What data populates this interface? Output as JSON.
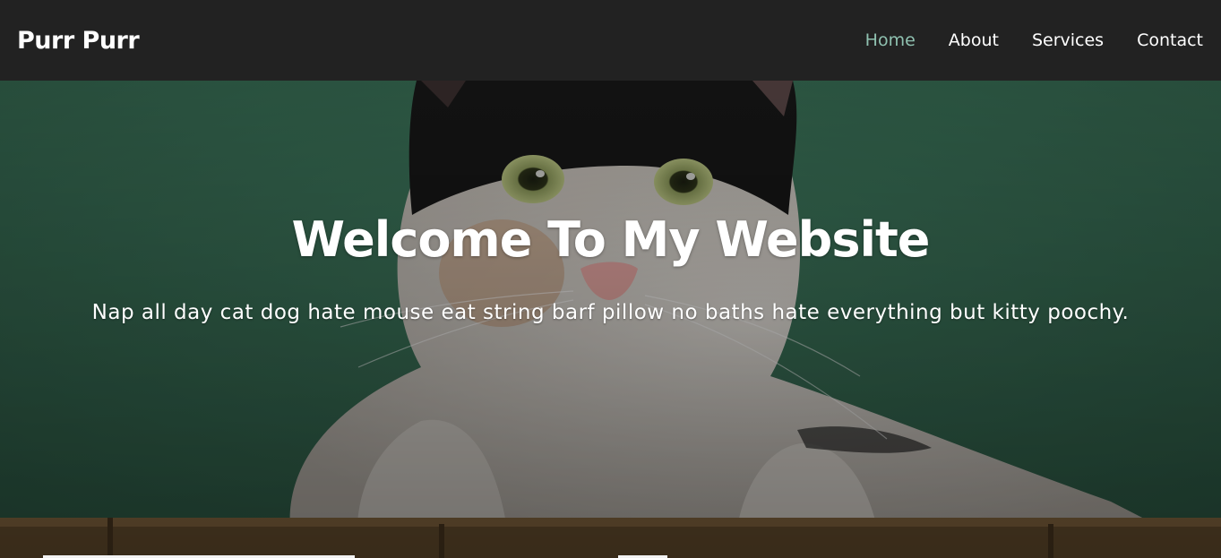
{
  "navbar": {
    "brand": "Purr Purr",
    "links": [
      {
        "label": "Home",
        "active": true
      },
      {
        "label": "About",
        "active": false
      },
      {
        "label": "Services",
        "active": false
      },
      {
        "label": "Contact",
        "active": false
      }
    ]
  },
  "hero": {
    "title": "Welcome To My Website",
    "subtitle": "Nap all day cat dog hate mouse eat string barf pillow no baths hate everything but kitty poochy."
  },
  "colors": {
    "navbar_bg": "#222222",
    "active_link": "#8fc1b0",
    "hero_wall": "#3a6b54"
  }
}
